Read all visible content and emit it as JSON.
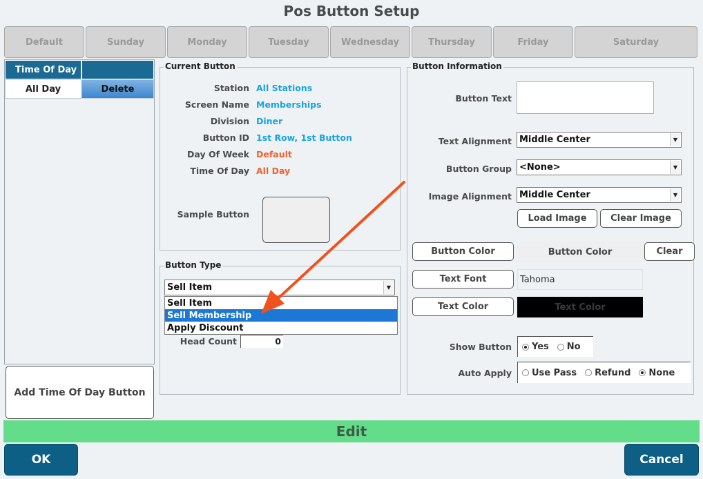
{
  "window": {
    "title": "Pos Button Setup"
  },
  "tabs": [
    "Default",
    "Sunday",
    "Monday",
    "Tuesday",
    "Wednesday",
    "Thursday",
    "Friday",
    "Saturday"
  ],
  "time_of_day_table": {
    "header": "Time Of Day",
    "row_label": "All Day",
    "row_action": "Delete"
  },
  "add_time_of_day_button": "Add Time Of Day Button",
  "current_button": {
    "group_title": "Current Button",
    "fields": [
      {
        "label": "Station",
        "value": "All Stations",
        "color": "#1aa3e0"
      },
      {
        "label": "Screen Name",
        "value": "Memberships",
        "color": "#1aa3e0"
      },
      {
        "label": "Division",
        "value": "Diner",
        "color": "#1aa3e0"
      },
      {
        "label": "Button ID",
        "value": "1st Row, 1st Button",
        "color": "#1aa3e0"
      },
      {
        "label": "Day Of Week",
        "value": "Default",
        "color": "#f0622d"
      },
      {
        "label": "Time Of Day",
        "value": "All Day",
        "color": "#f0622d"
      }
    ],
    "sample_label": "Sample Button"
  },
  "button_type": {
    "group_title": "Button Type",
    "selected": "Sell Item",
    "options": [
      "Sell Item",
      "Sell Membership",
      "Apply Discount"
    ],
    "highlighted_index": 1,
    "head_count_label": "Head Count",
    "head_count_value": "0"
  },
  "button_information": {
    "group_title": "Button Information",
    "button_text_label": "Button Text",
    "button_text_value": "",
    "text_alignment_label": "Text Alignment",
    "text_alignment_value": "Middle Center",
    "button_group_label": "Button Group",
    "button_group_value": "<None>",
    "image_alignment_label": "Image Alignment",
    "image_alignment_value": "Middle Center",
    "load_image": "Load Image",
    "clear_image": "Clear Image",
    "button_color_button": "Button Color",
    "button_color_preview": "Button Color",
    "clear": "Clear",
    "text_font_button": "Text Font",
    "text_font_value": "Tahoma",
    "text_color_button": "Text Color",
    "text_color_preview": "Text Color",
    "show_button_label": "Show Button",
    "show_button_options": [
      "Yes",
      "No"
    ],
    "show_button_selected": "Yes",
    "auto_apply_label": "Auto Apply",
    "auto_apply_options": [
      "Use Pass",
      "Refund",
      "None"
    ],
    "auto_apply_selected": "None"
  },
  "mode_bar": "Edit",
  "footer": {
    "ok": "OK",
    "cancel": "Cancel"
  },
  "colors": {
    "header_blue": "#1b6a94",
    "selected_blue": "#1c78d4",
    "edit_green": "#64dd8b",
    "dark_button": "#0e5f86",
    "arrow_annotation": "#f0521e"
  }
}
